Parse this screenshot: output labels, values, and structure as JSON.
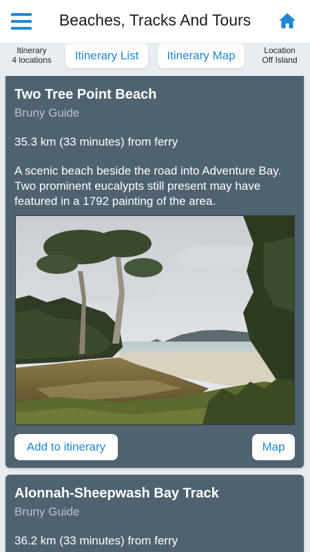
{
  "header": {
    "title": "Beaches, Tracks And Tours",
    "menu_icon": "hamburger-menu-icon",
    "home_icon": "home-icon",
    "accent_color": "#1e88d6"
  },
  "subbar": {
    "itinerary_label": "Itinerary",
    "itinerary_count": "4 locations",
    "tab_list": "Itinerary List",
    "tab_map": "Itinerary Map",
    "location_label": "Location",
    "location_value": "Off Island"
  },
  "cards": [
    {
      "title": "Two Tree Point Beach",
      "source": "Bruny Guide",
      "distance": "35.3 km (33 minutes) from ferry",
      "description": "A scenic beach beside the road into Adventure Bay. Two prominent eucalypts still present may have featured in a 1792 painting of the area.",
      "add_button": "Add to itinerary",
      "map_button": "Map"
    },
    {
      "title": "Alonnah-Sheepwash Bay Track",
      "source": "Bruny Guide",
      "distance": "36.2 km (33 minutes) from ferry"
    }
  ]
}
